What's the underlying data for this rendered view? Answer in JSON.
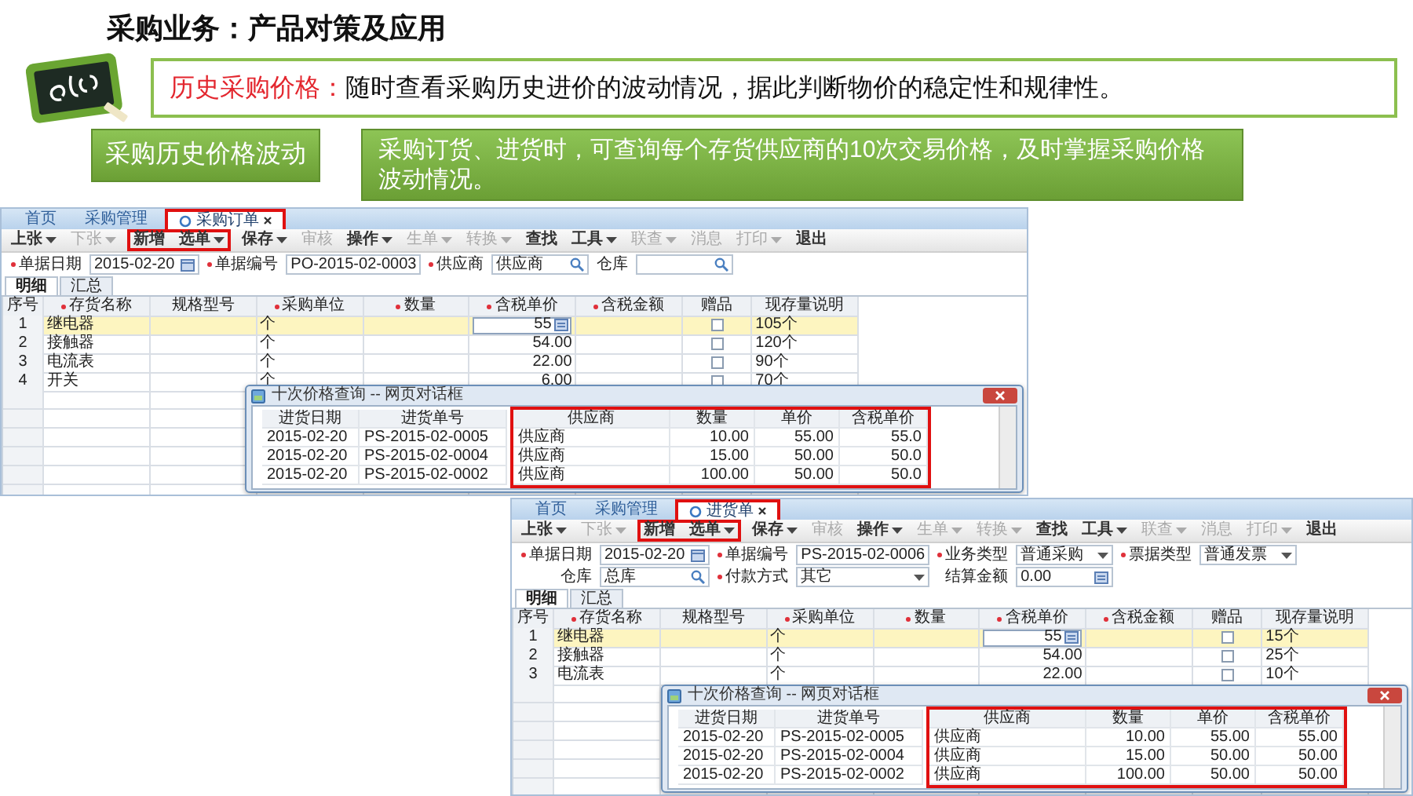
{
  "title": "采购业务：产品对策及应用",
  "banner": {
    "label": "历史采购价格：",
    "text": "随时查看采购历史进价的波动情况，据此判断物价的稳定性和规律性。"
  },
  "feature_label": "采购历史价格波动",
  "feature_note": "采购订货、进货时，可查询每个存货供应商的10次交易价格，及时掌握采购价格波动情况。",
  "screens": [
    {
      "tabs": [
        {
          "label": "首页",
          "selected": false,
          "highlighted": false
        },
        {
          "label": "采购管理",
          "selected": false,
          "highlighted": false
        },
        {
          "label": "采购订单",
          "selected": true,
          "highlighted": true
        }
      ],
      "toolbar": [
        {
          "label": "上张",
          "menu": true,
          "disabled": false,
          "highlighted": false
        },
        {
          "label": "下张",
          "menu": true,
          "disabled": true,
          "highlighted": false
        },
        {
          "label": "新增",
          "menu": false,
          "disabled": false,
          "highlighted": true
        },
        {
          "label": "选单",
          "menu": true,
          "disabled": false,
          "highlighted": true
        },
        {
          "label": "保存",
          "menu": true,
          "disabled": false,
          "highlighted": false
        },
        {
          "label": "审核",
          "menu": false,
          "disabled": true,
          "highlighted": false
        },
        {
          "label": "操作",
          "menu": true,
          "disabled": false,
          "highlighted": false
        },
        {
          "label": "生单",
          "menu": true,
          "disabled": true,
          "highlighted": false
        },
        {
          "label": "转换",
          "menu": true,
          "disabled": true,
          "highlighted": false
        },
        {
          "label": "查找",
          "menu": false,
          "disabled": false,
          "highlighted": false
        },
        {
          "label": "工具",
          "menu": true,
          "disabled": false,
          "highlighted": false
        },
        {
          "label": "联查",
          "menu": true,
          "disabled": true,
          "highlighted": false
        },
        {
          "label": "消息",
          "menu": false,
          "disabled": true,
          "highlighted": false
        },
        {
          "label": "打印",
          "menu": true,
          "disabled": true,
          "highlighted": false
        },
        {
          "label": "退出",
          "menu": false,
          "disabled": false,
          "highlighted": false
        }
      ],
      "form": [
        [
          {
            "label": "单据日期",
            "value": "2015-02-20",
            "required": true,
            "kind": "date"
          },
          {
            "label": "单据编号",
            "value": "PO-2015-02-0003",
            "required": true,
            "kind": "text"
          },
          {
            "label": "供应商",
            "value": "供应商",
            "required": true,
            "kind": "search"
          },
          {
            "label": "仓库",
            "required": false,
            "kind": "search"
          }
        ]
      ],
      "subtabs": [
        {
          "label": "明细",
          "selected": true
        },
        {
          "label": "汇总",
          "selected": false
        }
      ],
      "columns": [
        {
          "label": "序号",
          "required": false
        },
        {
          "label": "存货名称",
          "required": true
        },
        {
          "label": "规格型号",
          "required": false
        },
        {
          "label": "采购单位",
          "required": true
        },
        {
          "label": "数量",
          "required": true
        },
        {
          "label": "含税单价",
          "required": true
        },
        {
          "label": "含税金额",
          "required": true
        },
        {
          "label": "赠品",
          "required": false
        },
        {
          "label": "现存量说明",
          "required": false
        }
      ],
      "rows": [
        {
          "no": "1",
          "item": "继电器",
          "unit": "个",
          "price": "55",
          "stock": "105个",
          "gift": false,
          "selected": true,
          "editing": true
        },
        {
          "no": "2",
          "item": "接触器",
          "unit": "个",
          "price": "54.00",
          "stock": "120个",
          "gift": false,
          "selected": false,
          "editing": false
        },
        {
          "no": "3",
          "item": "电流表",
          "unit": "个",
          "price": "22.00",
          "stock": "90个",
          "gift": false,
          "selected": false,
          "editing": false
        },
        {
          "no": "4",
          "item": "开关",
          "unit": "个",
          "price": "6.00",
          "stock": "70个",
          "gift": false,
          "selected": false,
          "editing": false
        }
      ],
      "dialog": {
        "title": "十次价格查询 -- 网页对话框",
        "columns": [
          {
            "label": "进货日期",
            "highlighted": false,
            "kind": "text"
          },
          {
            "label": "进货单号",
            "highlighted": false,
            "kind": "text"
          },
          {
            "label": "供应商",
            "highlighted": true,
            "kind": "text"
          },
          {
            "label": "数量",
            "highlighted": true,
            "kind": "number"
          },
          {
            "label": "单价",
            "highlighted": true,
            "kind": "number"
          },
          {
            "label": "含税单价",
            "highlighted": true,
            "kind": "number"
          }
        ],
        "rows": [
          [
            "2015-02-20",
            "PS-2015-02-0005",
            "供应商",
            "10.00",
            "55.00",
            "55.0"
          ],
          [
            "2015-02-20",
            "PS-2015-02-0004",
            "供应商",
            "15.00",
            "50.00",
            "50.0"
          ],
          [
            "2015-02-20",
            "PS-2015-02-0002",
            "供应商",
            "100.00",
            "50.00",
            "50.0"
          ]
        ]
      }
    },
    {
      "tabs": [
        {
          "label": "首页",
          "selected": false,
          "highlighted": false
        },
        {
          "label": "采购管理",
          "selected": false,
          "highlighted": false
        },
        {
          "label": "进货单",
          "selected": true,
          "highlighted": true
        }
      ],
      "toolbar": [
        {
          "label": "上张",
          "menu": true,
          "disabled": false,
          "highlighted": false
        },
        {
          "label": "下张",
          "menu": true,
          "disabled": true,
          "highlighted": false
        },
        {
          "label": "新增",
          "menu": false,
          "disabled": false,
          "highlighted": true
        },
        {
          "label": "选单",
          "menu": true,
          "disabled": false,
          "highlighted": true
        },
        {
          "label": "保存",
          "menu": true,
          "disabled": false,
          "highlighted": false
        },
        {
          "label": "审核",
          "menu": false,
          "disabled": true,
          "highlighted": false
        },
        {
          "label": "操作",
          "menu": true,
          "disabled": false,
          "highlighted": false
        },
        {
          "label": "生单",
          "menu": true,
          "disabled": true,
          "highlighted": false
        },
        {
          "label": "转换",
          "menu": true,
          "disabled": true,
          "highlighted": false
        },
        {
          "label": "查找",
          "menu": false,
          "disabled": false,
          "highlighted": false
        },
        {
          "label": "工具",
          "menu": true,
          "disabled": false,
          "highlighted": false
        },
        {
          "label": "联查",
          "menu": true,
          "disabled": true,
          "highlighted": false
        },
        {
          "label": "消息",
          "menu": false,
          "disabled": true,
          "highlighted": false
        },
        {
          "label": "打印",
          "menu": true,
          "disabled": true,
          "highlighted": false
        },
        {
          "label": "退出",
          "menu": false,
          "disabled": false,
          "highlighted": false
        }
      ],
      "form": [
        [
          {
            "label": "单据日期",
            "value": "2015-02-20",
            "required": true,
            "kind": "date"
          },
          {
            "label": "单据编号",
            "value": "PS-2015-02-0006",
            "required": true,
            "kind": "text"
          },
          {
            "label": "业务类型",
            "value": "普通采购",
            "required": true,
            "kind": "select"
          },
          {
            "label": "票据类型",
            "value": "普通发票",
            "required": true,
            "kind": "select"
          }
        ],
        [
          {
            "label": "仓库",
            "value": "总库",
            "required": false,
            "kind": "search"
          },
          {
            "label": "付款方式",
            "value": "其它",
            "required": true,
            "kind": "select"
          },
          {
            "label": "结算金额",
            "value": "0.00",
            "required": false,
            "kind": "calc"
          }
        ]
      ],
      "subtabs": [
        {
          "label": "明细",
          "selected": true
        },
        {
          "label": "汇总",
          "selected": false
        }
      ],
      "columns": [
        {
          "label": "序号",
          "required": false
        },
        {
          "label": "存货名称",
          "required": true
        },
        {
          "label": "规格型号",
          "required": false
        },
        {
          "label": "采购单位",
          "required": true
        },
        {
          "label": "数量",
          "required": true
        },
        {
          "label": "含税单价",
          "required": true
        },
        {
          "label": "含税金额",
          "required": true
        },
        {
          "label": "赠品",
          "required": false
        },
        {
          "label": "现存量说明",
          "required": false
        }
      ],
      "rows": [
        {
          "no": "1",
          "item": "继电器",
          "unit": "个",
          "price": "55",
          "stock": "15个",
          "gift": false,
          "selected": true,
          "editing": true
        },
        {
          "no": "2",
          "item": "接触器",
          "unit": "个",
          "price": "54.00",
          "stock": "25个",
          "gift": false,
          "selected": false,
          "editing": false
        },
        {
          "no": "3",
          "item": "电流表",
          "unit": "个",
          "price": "22.00",
          "stock": "10个",
          "gift": false,
          "selected": false,
          "editing": false
        }
      ],
      "dialog": {
        "title": "十次价格查询 -- 网页对话框",
        "columns": [
          {
            "label": "进货日期",
            "highlighted": false,
            "kind": "text"
          },
          {
            "label": "进货单号",
            "highlighted": false,
            "kind": "text"
          },
          {
            "label": "供应商",
            "highlighted": true,
            "kind": "text"
          },
          {
            "label": "数量",
            "highlighted": true,
            "kind": "number"
          },
          {
            "label": "单价",
            "highlighted": true,
            "kind": "number"
          },
          {
            "label": "含税单价",
            "highlighted": true,
            "kind": "number"
          }
        ],
        "rows": [
          [
            "2015-02-20",
            "PS-2015-02-0005",
            "供应商",
            "10.00",
            "55.00",
            "55.00"
          ],
          [
            "2015-02-20",
            "PS-2015-02-0004",
            "供应商",
            "15.00",
            "50.00",
            "50.00"
          ],
          [
            "2015-02-20",
            "PS-2015-02-0002",
            "供应商",
            "100.00",
            "50.00",
            "50.00"
          ]
        ]
      }
    }
  ]
}
